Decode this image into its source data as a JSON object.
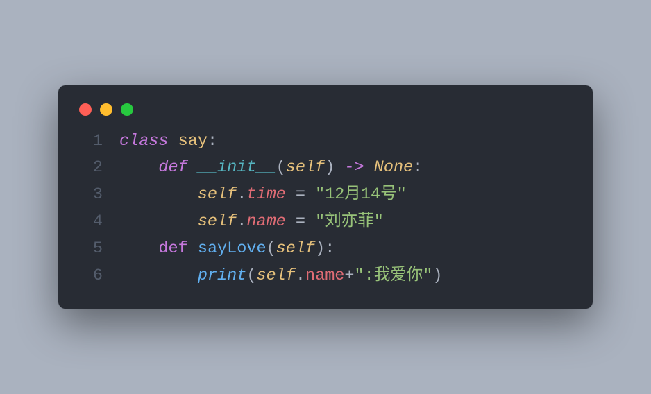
{
  "window": {
    "dots": [
      "close",
      "minimize",
      "zoom"
    ]
  },
  "code": {
    "lines": [
      {
        "n": "1"
      },
      {
        "n": "2"
      },
      {
        "n": "3"
      },
      {
        "n": "4"
      },
      {
        "n": "5"
      },
      {
        "n": "6"
      }
    ],
    "tokens": {
      "kw_class": "class",
      "cls_say": "say",
      "colon": ":",
      "kw_def": "def",
      "fn_init": "__init__",
      "lp": "(",
      "rp": ")",
      "self": "self",
      "arrow": " -> ",
      "none": "None",
      "dot": ".",
      "attr_time": "time",
      "attr_name": "name",
      "eq": " = ",
      "str_time": "\"12月14号\"",
      "str_name": "\"刘亦菲\"",
      "fn_sayLove": "sayLove",
      "fn_print": "print",
      "plus": "+",
      "str_love": "\":我爱你\""
    },
    "indent1": "    ",
    "indent2": "        "
  }
}
